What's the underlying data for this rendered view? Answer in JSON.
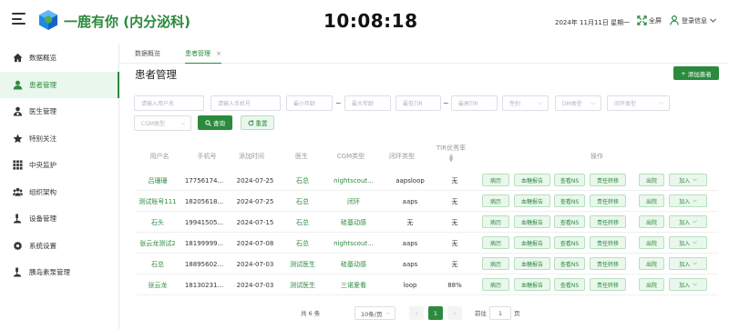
{
  "header": {
    "brand": "一鹿有你 (内分泌科)",
    "clock": "10:08:18",
    "date": "2024年 11月11日 星期一",
    "fullscreen_label": "全屏",
    "user_label": "登录信息"
  },
  "sidebar": {
    "items": [
      {
        "label": "数据概览",
        "icon": "home-icon"
      },
      {
        "label": "患者管理",
        "icon": "user-icon"
      },
      {
        "label": "医生管理",
        "icon": "doctor-icon"
      },
      {
        "label": "特别关注",
        "icon": "star-icon"
      },
      {
        "label": "中央监护",
        "icon": "grid-icon"
      },
      {
        "label": "组织架构",
        "icon": "org-icon"
      },
      {
        "label": "设备管理",
        "icon": "device-icon"
      },
      {
        "label": "系统设置",
        "icon": "gear-icon"
      },
      {
        "label": "胰岛素泵管理",
        "icon": "pump-icon"
      }
    ]
  },
  "tabs": [
    {
      "label": "数据概览"
    },
    {
      "label": "患者管理",
      "close": "×"
    }
  ],
  "page": {
    "title": "患者管理",
    "add_button": "添加患者"
  },
  "filters": {
    "name": "请输入用户名",
    "phone": "请输入手机号",
    "min_age": "最小年龄",
    "max_age": "最大年龄",
    "tir_min": "最低TIR",
    "tir_max": "最高TIR",
    "gender": "性别",
    "dm_type": "DM类型",
    "loop_type": "闭环类型",
    "cgm_type": "CGM类型",
    "separator": "~",
    "search_btn": "查询",
    "reset_btn": "重置"
  },
  "table": {
    "columns": [
      "用户名",
      "手机号",
      "添加时间",
      "医生",
      "CGM类型",
      "闭环类型",
      "TIR优秀率",
      "操作"
    ],
    "rows": [
      {
        "name": "吕珊珊",
        "phone": "17756174...",
        "date": "2024-07-25",
        "doctor": "石总",
        "cgm": "nightscout...",
        "loop": "aapsloop",
        "tir": "无"
      },
      {
        "name": "测试账号111",
        "phone": "18205618...",
        "date": "2024-07-25",
        "doctor": "石总",
        "cgm": "闭环",
        "loop": "aaps",
        "tir": "无"
      },
      {
        "name": "石头",
        "phone": "19941505...",
        "date": "2024-07-15",
        "doctor": "石总",
        "cgm": "硅基动感",
        "loop": "无",
        "tir": "无"
      },
      {
        "name": "张云龙测试2",
        "phone": "18199999...",
        "date": "2024-07-08",
        "doctor": "石总",
        "cgm": "nightscout...",
        "loop": "aaps",
        "tir": "无"
      },
      {
        "name": "石总",
        "phone": "18895602...",
        "date": "2024-07-03",
        "doctor": "测试医生",
        "cgm": "硅基动感",
        "loop": "aaps",
        "tir": "无"
      },
      {
        "name": "张云龙",
        "phone": "18130231...",
        "date": "2024-07-03",
        "doctor": "测试医生",
        "cgm": "三诺爱看",
        "loop": "loop",
        "tir": "88%"
      }
    ],
    "actions": [
      "病历",
      "血糖报告",
      "查看NS",
      "责任转移",
      "出院",
      "加入"
    ]
  },
  "pagination": {
    "total": "共 6 条",
    "page_size": "10条/页",
    "current_page": "1",
    "goto_label": "前往",
    "goto_value": "1",
    "page_suffix": "页"
  },
  "colors": {
    "primary": "#2b8a3e",
    "primary_light": "#eaf7ec"
  }
}
